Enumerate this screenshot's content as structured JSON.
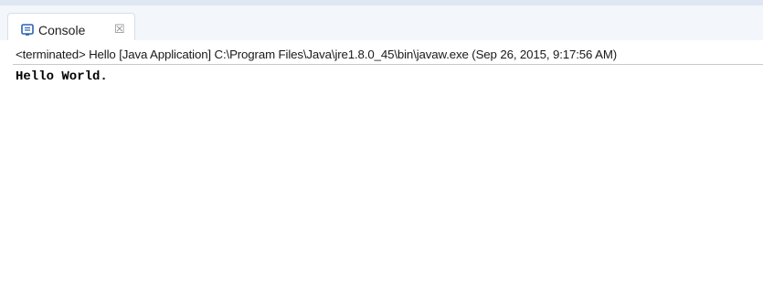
{
  "console_view": {
    "tab": {
      "label": "Console",
      "icon": "console-icon",
      "close_icon": "close-icon",
      "close_glyph": "☒"
    },
    "status": {
      "text": "<terminated> Hello [Java Application] C:\\Program Files\\Java\\jre1.8.0_45\\bin\\javaw.exe (Sep 26, 2015, 9:17:56 AM)"
    },
    "output": {
      "lines": [
        "Hello World."
      ]
    },
    "colors": {
      "icon_blue": "#2a62b6",
      "tab_background": "#ffffff",
      "strip_background": "#f3f6fa"
    }
  }
}
